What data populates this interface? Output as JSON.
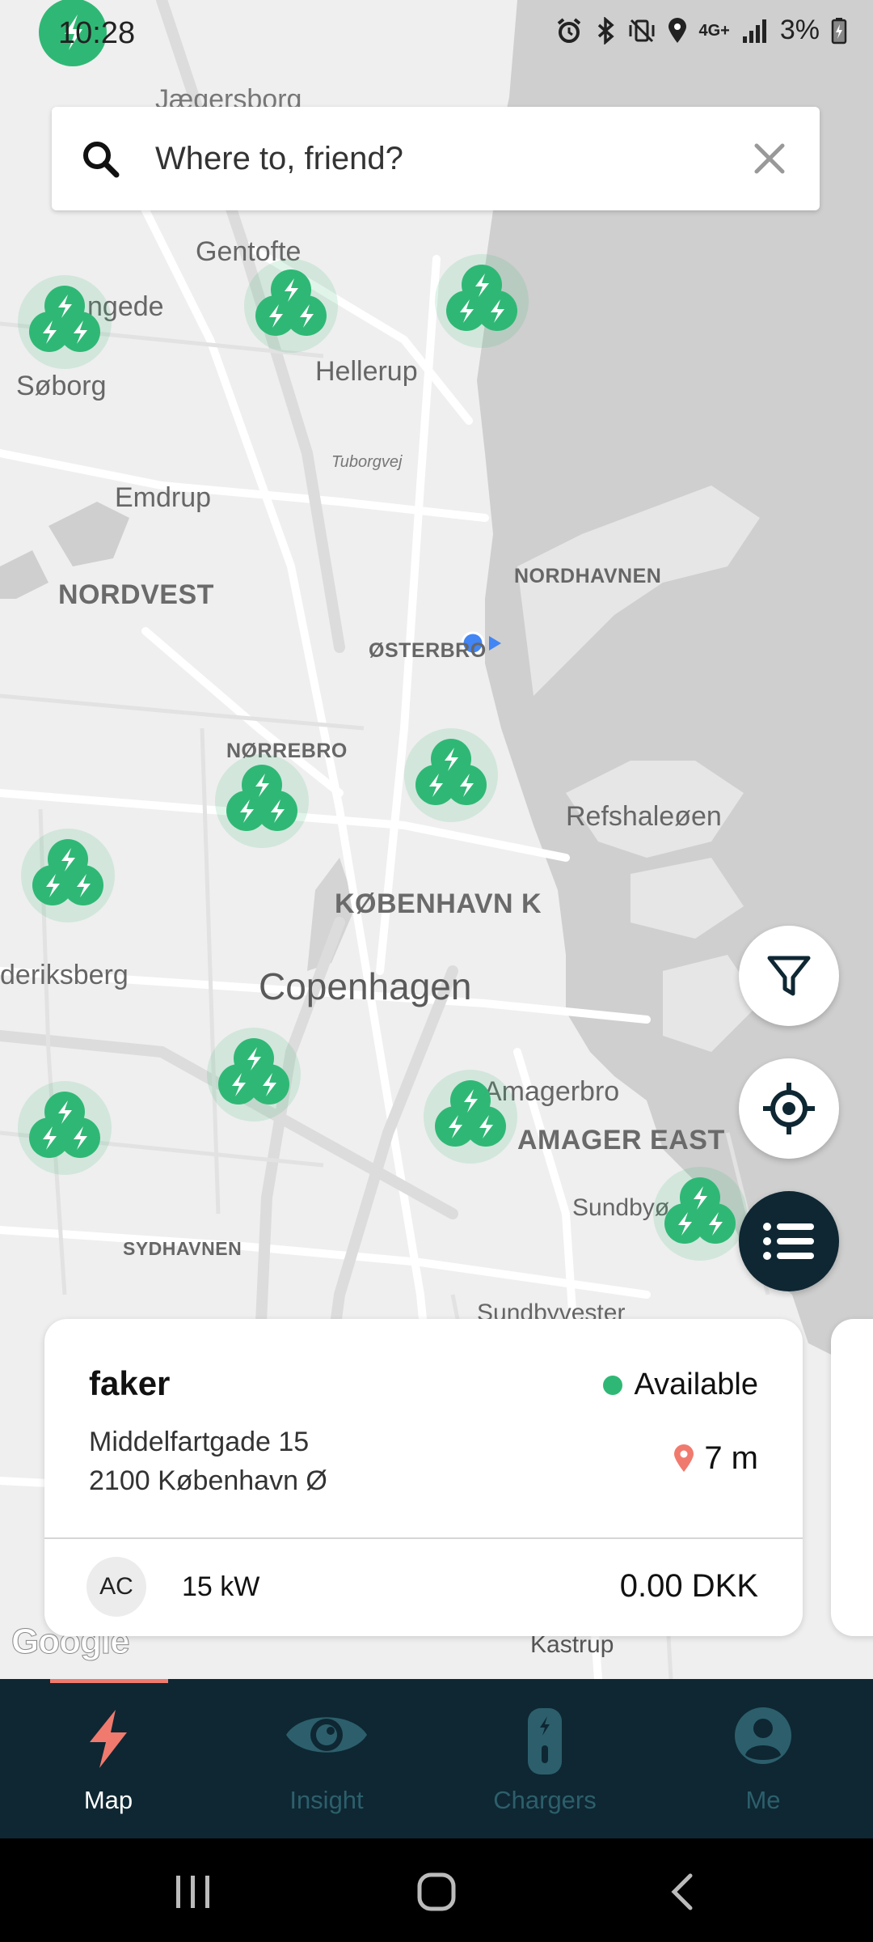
{
  "status_bar": {
    "time": "10:28",
    "battery": "3%",
    "icons": [
      "alarm-icon",
      "bluetooth-icon",
      "vibrate-icon",
      "location-icon",
      "4g-icon",
      "signal-icon",
      "battery-charging-icon"
    ],
    "network": "4G+"
  },
  "search": {
    "placeholder": "Where to, friend?",
    "search_icon": "search-icon",
    "clear_icon": "close-icon"
  },
  "map": {
    "places": {
      "jaegersborg": "Jægersborg",
      "gentofte": "Gentofte",
      "gladsaxe": "ngede",
      "soborg": "Søborg",
      "hellerup": "Hellerup",
      "tuborgvej": "Tuborgvej",
      "emdrup": "Emdrup",
      "nordvest": "NORDVEST",
      "nordhavnen": "NORDHAVNEN",
      "osterbro": "ØSTERBRO",
      "norrebro": "NØRREBRO",
      "refshaleoen": "Refshaleøen",
      "kobenhavn_k": "KØBENHAVN K",
      "frederiksberg": "deriksberg",
      "copenhagen": "Copenhagen",
      "amagerbro": "Amagerbro",
      "amager_east": "AMAGER EAST",
      "sundbyoster": "Sundbyø",
      "sydhavnen": "SYDHAVNEN",
      "sundbyvester": "Sundbyvester",
      "kastrup": "Kastrup"
    },
    "attribution": "Google",
    "colors": {
      "charger": "#2fb875",
      "water": "#cfcfcf",
      "land": "#efefef",
      "road": "#ffffff"
    }
  },
  "fabs": {
    "filter": "filter-icon",
    "locate": "crosshair-icon",
    "list": "list-icon"
  },
  "station_card": {
    "name": "faker",
    "status": "Available",
    "address_line1": "Middelfartgade 15",
    "address_line2": "2100 København Ø",
    "distance": "7 m",
    "connector": "AC",
    "power": "15 kW",
    "price": "0.00 DKK"
  },
  "bottom_nav": {
    "items": [
      {
        "label": "Map",
        "icon": "bolt-icon",
        "active": true
      },
      {
        "label": "Insight",
        "icon": "eye-icon",
        "active": false
      },
      {
        "label": "Chargers",
        "icon": "charger-icon",
        "active": false
      },
      {
        "label": "Me",
        "icon": "user-icon",
        "active": false
      }
    ],
    "active_color": "#f07a6e",
    "inactive_color": "#2c5f6b"
  }
}
